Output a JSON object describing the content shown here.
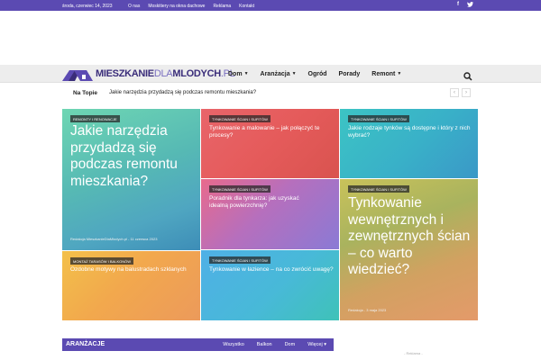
{
  "topbar": {
    "date": "środa, czerwiec 14, 2023",
    "links": [
      "O nas",
      "Moskitiery na okna dachowe",
      "Reklama",
      "Kontakt"
    ],
    "social": [
      "facebook-icon",
      "twitter-icon"
    ]
  },
  "logo": {
    "text_a": "MIESZKANIE",
    "text_b": "DLA",
    "text_c": "MLODYCH",
    "text_d": ".PL"
  },
  "nav": {
    "items": [
      {
        "label": "Dom",
        "dropdown": true
      },
      {
        "label": "Aranżacja",
        "dropdown": true
      },
      {
        "label": "Ogród",
        "dropdown": false
      },
      {
        "label": "Porady",
        "dropdown": false
      },
      {
        "label": "Remont",
        "dropdown": true
      }
    ]
  },
  "trending": {
    "label": "Na Topie",
    "headline": "Jakie narzędzia przydadzą się podczas remontu mieszkania?",
    "prev": "‹",
    "next": "›"
  },
  "tiles": [
    {
      "category": "REMONTY I RENOWACJE",
      "title": "Jakie narzędzia przydadzą się podczas remontu mieszkania?",
      "meta": "Redakcja MieszkanieDlaMlodych.pl  -  11 czerwca 2023"
    },
    {
      "category": "Tynkowanie ścian i sufitów",
      "title": "Tynkowanie a malowanie – jak połączyć te procesy?"
    },
    {
      "category": "Tynkowanie ścian i sufitów",
      "title": "Jakie rodzaje tynków są dostępne i który z nich wybrać?"
    },
    {
      "category": "Tynkowanie ścian i sufitów",
      "title": "Poradnik dla tynkarza: jak uzyskać idealną powierzchnię?"
    },
    {
      "category": "Tynkowanie ścian i sufitów",
      "title": "Tynkowanie wewnętrznych i zewnętrznych ścian – co warto wiedzieć?",
      "meta": "Redakcja  -  3 maja 2023"
    },
    {
      "category": "MONTAŻ TARASÓW I BALKONÓW",
      "title": "Ozdobne motywy na balustradach szklanych"
    },
    {
      "category": "Tynkowanie ścian i sufitów",
      "title": "Tynkowanie w łazience – na co zwrócić uwagę?"
    }
  ],
  "section": {
    "name": "ARANŻACJE",
    "filters": [
      "Wszystko",
      "Balkon",
      "Dom",
      "Więcej ▾"
    ]
  },
  "ad_label": "- Reklama -",
  "colors": {
    "brand": "#5b4ab2",
    "logo": "#3a2d7a"
  }
}
